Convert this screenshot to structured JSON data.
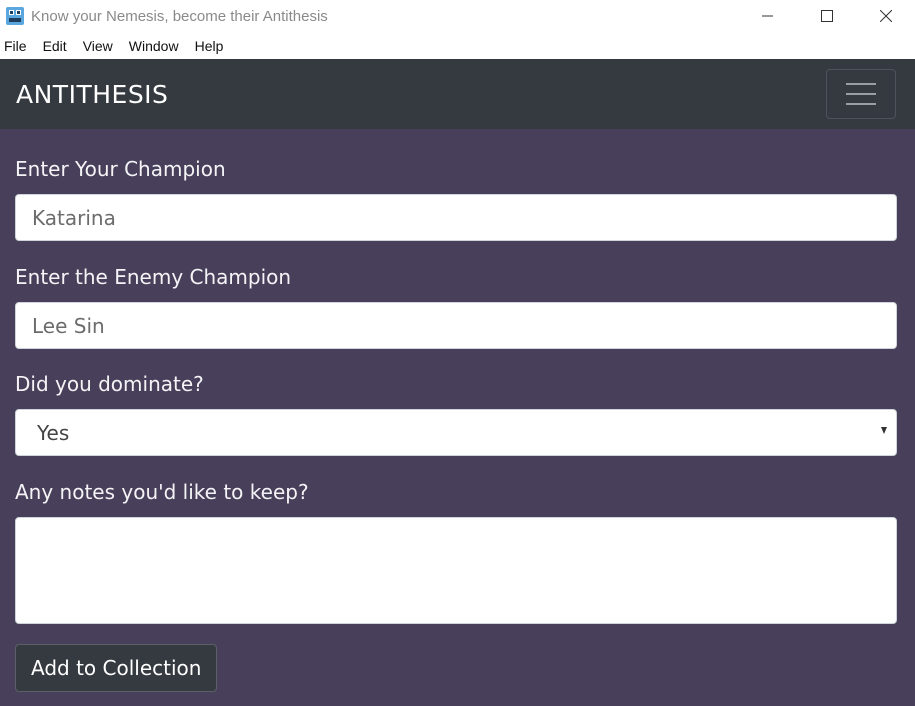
{
  "window": {
    "title": "Know your Nemesis, become their Antithesis"
  },
  "menu": {
    "items": [
      "File",
      "Edit",
      "View",
      "Window",
      "Help"
    ]
  },
  "navbar": {
    "brand": "ANTITHESIS"
  },
  "form": {
    "champion_label": "Enter Your Champion",
    "champion_value": "Katarina",
    "enemy_label": "Enter the Enemy Champion",
    "enemy_value": "Lee Sin",
    "dominate_label": "Did you dominate?",
    "dominate_selected": "Yes",
    "notes_label": "Any notes you'd like to keep?",
    "notes_value": "",
    "submit_label": "Add to Collection"
  },
  "colors": {
    "navbar_bg": "#343a40",
    "content_bg": "#483f5a",
    "label_text": "#f4f4f6"
  },
  "icons": {
    "app": "app-logo-icon",
    "minimize": "minimize-icon",
    "maximize": "maximize-icon",
    "close": "close-icon",
    "toggler": "hamburger-menu-icon",
    "select_arrow": "caret-down-icon",
    "resize": "resize-grip-icon"
  }
}
